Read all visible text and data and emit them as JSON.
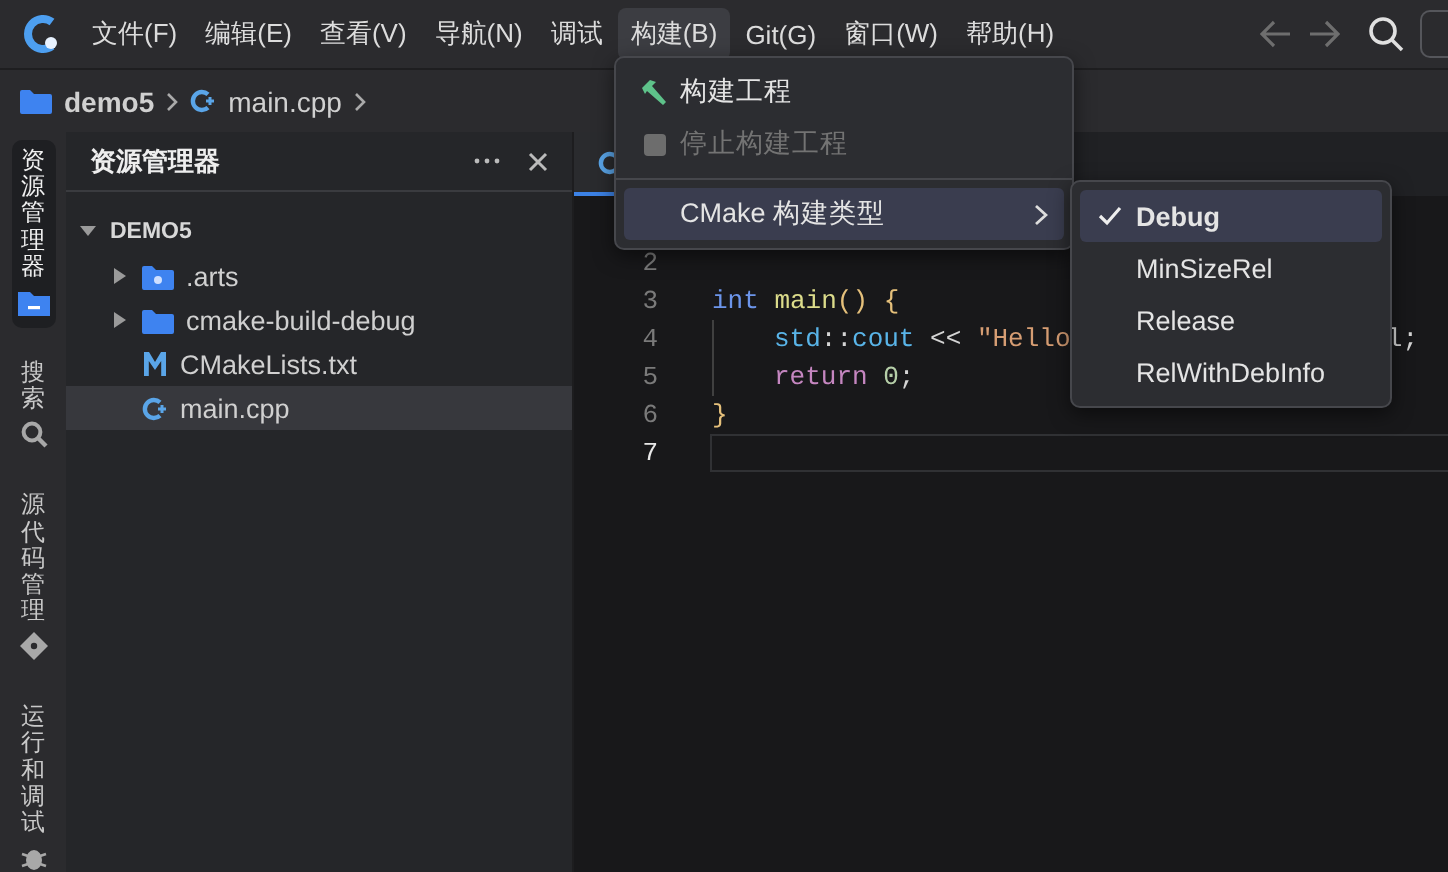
{
  "menubar": {
    "items": [
      {
        "label": "文件(F)",
        "selected": false
      },
      {
        "label": "编辑(E)",
        "selected": false
      },
      {
        "label": "查看(V)",
        "selected": false
      },
      {
        "label": "导航(N)",
        "selected": false
      },
      {
        "label": "调试",
        "selected": false
      },
      {
        "label": "构建(B)",
        "selected": true
      },
      {
        "label": "Git(G)",
        "selected": false
      },
      {
        "label": "窗口(W)",
        "selected": false
      },
      {
        "label": "帮助(H)",
        "selected": false
      }
    ]
  },
  "breadcrumb": [
    {
      "label": "demo5",
      "kind": "folder"
    },
    {
      "label": "main.cpp",
      "kind": "cpp"
    }
  ],
  "activity_bar": [
    {
      "label": "资源管理器",
      "kind": "explorer",
      "selected": true
    },
    {
      "label": "搜索",
      "kind": "search",
      "selected": false
    },
    {
      "label": "源代码管理",
      "kind": "scm",
      "selected": false
    },
    {
      "label": "运行和调试",
      "kind": "debug",
      "selected": false
    }
  ],
  "explorer": {
    "title": "资源管理器",
    "root": {
      "label": "DEMO5",
      "expanded": true,
      "children": [
        {
          "label": ".arts",
          "kind": "special-folder",
          "expanded": false,
          "selected": false
        },
        {
          "label": "cmake-build-debug",
          "kind": "folder",
          "expanded": false,
          "selected": false
        },
        {
          "label": "CMakeLists.txt",
          "kind": "cmake",
          "selected": false
        },
        {
          "label": "main.cpp",
          "kind": "cpp",
          "selected": true
        }
      ]
    }
  },
  "editor": {
    "lines": [
      {
        "number": "2",
        "current": false,
        "indent": false
      },
      {
        "number": "3",
        "current": false,
        "indent": false,
        "tokens": [
          {
            "text": "int",
            "kind": "keyword",
            "space": false
          },
          {
            "text": "main",
            "kind": "function",
            "space": true
          },
          {
            "text": "()",
            "kind": "bracket",
            "space": false
          },
          {
            "text": "{",
            "kind": "bracket",
            "space": true
          }
        ]
      },
      {
        "number": "4",
        "current": false,
        "indent": true,
        "tokens": [
          {
            "text": "std",
            "kind": "type",
            "space": false
          },
          {
            "text": "::",
            "kind": "plain",
            "space": false
          },
          {
            "text": "cout",
            "kind": "type",
            "space": false
          },
          {
            "text": "<<",
            "kind": "plain",
            "space": true
          },
          {
            "text": "\"Hello",
            "kind": "string",
            "space": true
          }
        ],
        "tail": [
          {
            "text": "l;",
            "kind": "plain",
            "space": false
          }
        ]
      },
      {
        "number": "5",
        "current": false,
        "indent": true,
        "tokens": [
          {
            "text": "return",
            "kind": "control",
            "space": false
          },
          {
            "text": "0",
            "kind": "number",
            "space": true
          },
          {
            "text": ";",
            "kind": "plain",
            "space": false
          }
        ]
      },
      {
        "number": "6",
        "current": false,
        "indent": false,
        "tokens": [
          {
            "text": "}",
            "kind": "bracket",
            "space": false
          }
        ]
      },
      {
        "number": "7",
        "current": true,
        "indent": false
      }
    ]
  },
  "build_menu": {
    "items": [
      {
        "kind": "hammer",
        "label": "构建工程",
        "disabled": false,
        "selected": false
      },
      {
        "kind": "stop",
        "label": "停止构建工程",
        "disabled": true,
        "selected": false
      },
      {
        "kind": "separator"
      },
      {
        "kind": "submenu",
        "label": "CMake 构建类型",
        "disabled": false,
        "selected": true
      }
    ]
  },
  "build_type_menu": {
    "items": [
      {
        "label": "Debug",
        "checked": true,
        "selected": true
      },
      {
        "label": "MinSizeRel",
        "checked": false,
        "selected": false
      },
      {
        "label": "Release",
        "checked": false,
        "selected": false
      },
      {
        "label": "RelWithDebInfo",
        "checked": false,
        "selected": false
      }
    ]
  }
}
